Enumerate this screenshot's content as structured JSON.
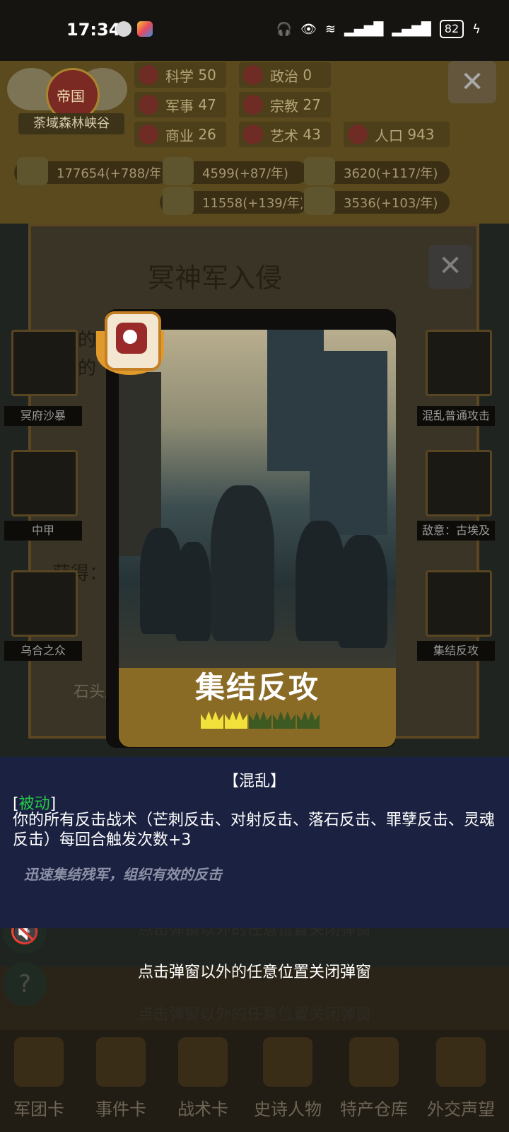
{
  "status_bar": {
    "time": "17:34",
    "battery": "82"
  },
  "empire": {
    "title": "帝国",
    "name": "荼域森林峡谷"
  },
  "stats": [
    {
      "label": "科学",
      "value": "50"
    },
    {
      "label": "政治",
      "value": "0"
    },
    {
      "label": "军事",
      "value": "47"
    },
    {
      "label": "宗教",
      "value": "27"
    },
    {
      "label": "商业",
      "value": "26"
    },
    {
      "label": "艺术",
      "value": "43"
    },
    {
      "label": "人口",
      "value": "943"
    }
  ],
  "resources": [
    "177654(+788/年)",
    "4599(+87/年)",
    "3620(+117/年)",
    "11558(+139/年)",
    "3536(+103/年)"
  ],
  "event_panel": {
    "title": "冥神军入侵",
    "left_cards": [
      "冥府沙暴",
      "中甲",
      "乌合之众"
    ],
    "right_cards": [
      "混乱普通攻击",
      "敌意：古埃及",
      "集结反攻"
    ],
    "faint_lines": [
      "你的",
      "你的",
      "获得："
    ],
    "reward_label": "石头产"
  },
  "card": {
    "name": "集结反攻",
    "stars_filled": 2,
    "stars_total": 5
  },
  "description": {
    "category": "【混乱】",
    "type_open": "[",
    "type_tag": "被动",
    "type_close": "]",
    "effect": "你的所有反击战术（芒刺反击、对射反击、落石反击、罪孽反击、灵魂反击）每回合触发次数+3",
    "flavor": "迅速集结残军，组织有效的反击"
  },
  "close_hint": "点击弹窗以外的任意位置关闭弹窗",
  "faint_hints": [
    "点击弹窗以外的任意位置关闭弹窗",
    "点击弹窗以外的任意位置关闭弹窗"
  ],
  "bottom_nav": [
    "军团卡",
    "事件卡",
    "战术卡",
    "史诗人物",
    "特产仓库",
    "外交声望"
  ]
}
